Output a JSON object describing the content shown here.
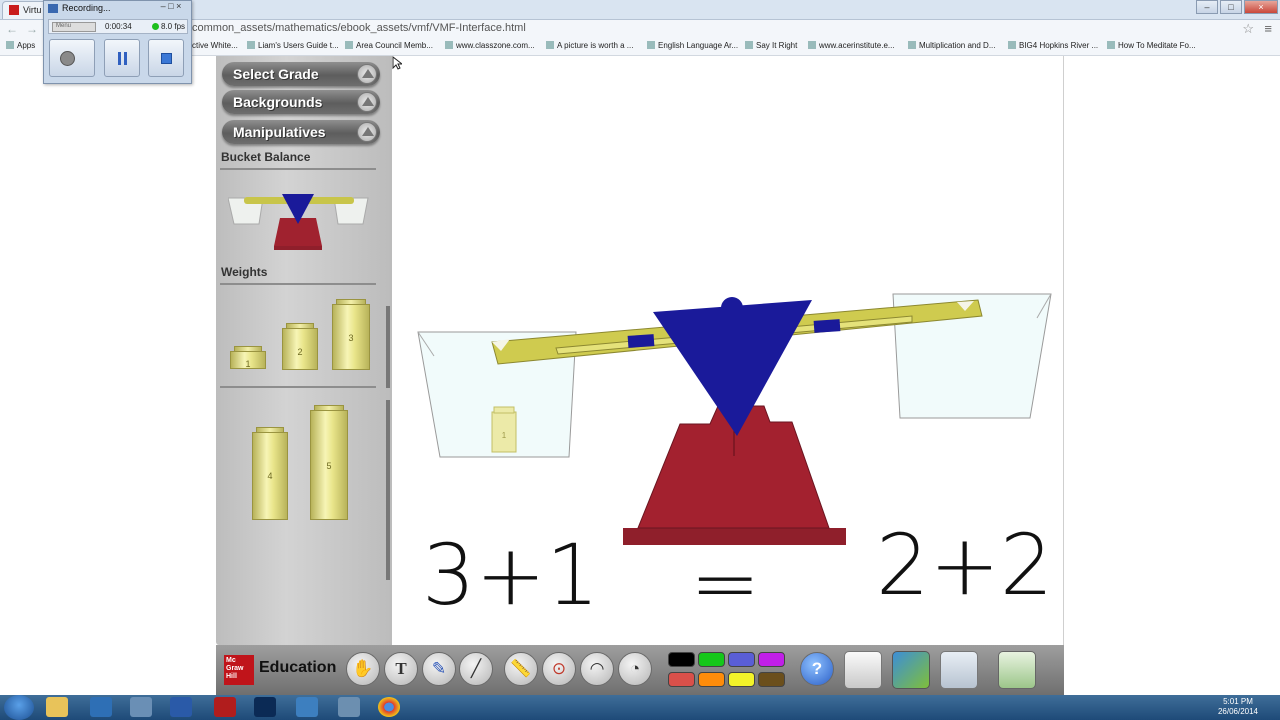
{
  "browser": {
    "tab_title": "Virtu",
    "url": "common_assets/mathematics/ebook_assets/vmf/VMF-Interface.html",
    "bookmarks": [
      "Apps",
      "ctive White...",
      "Liam's Users Guide t...",
      "Area Council Memb...",
      "www.classzone.com...",
      "A picture is worth a ...",
      "English Language Ar...",
      "Say It Right",
      "www.acerinstitute.e...",
      "Multiplication and D...",
      "BIG4 Hopkins River ...",
      "How To Meditate Fo..."
    ]
  },
  "recorder": {
    "title": "Recording...",
    "menu_label": "Menu",
    "elapsed": "0:00:34",
    "fps": "8.0 fps"
  },
  "sidebar": {
    "menus": [
      "Select Grade",
      "Backgrounds",
      "Manipulatives"
    ],
    "section_bucket": "Bucket Balance",
    "section_weights": "Weights",
    "weights": [
      "1",
      "2",
      "3",
      "4",
      "5"
    ]
  },
  "toolbar": {
    "brand": "Education",
    "logo": "Mc Graw Hill",
    "colors": [
      "#000000",
      "#15c71a",
      "#5a5ed6",
      "#c11fe8",
      "#d9504a",
      "#ff8c0a",
      "#f3f329",
      "#6b4f1c"
    ]
  },
  "canvas": {
    "left_expression": "3+1",
    "equals": "=",
    "right_expression": "2+2",
    "left_bucket_weight": "1"
  },
  "taskbar": {
    "time": "5:01 PM",
    "date": "26/06/2014"
  }
}
